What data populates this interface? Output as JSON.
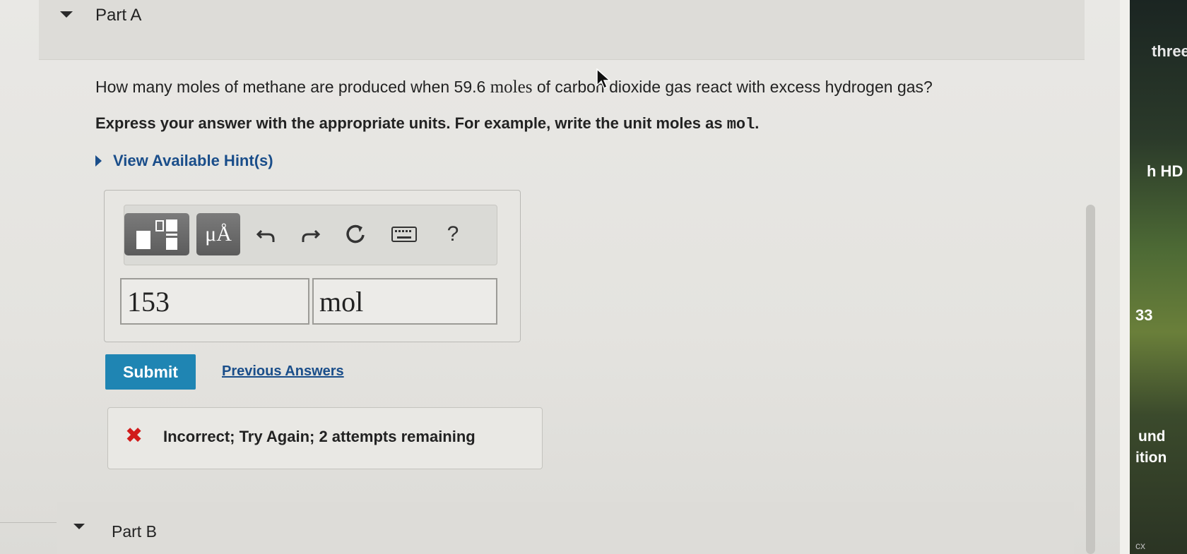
{
  "part_a": {
    "title": "Part A"
  },
  "question": {
    "prefix": "How many moles of methane are produced when 59.6",
    "unit_word": "moles",
    "suffix": "of carbon dioxide gas react with excess hydrogen gas?"
  },
  "instruction": {
    "text": "Express your answer with the appropriate units. For example, write the unit moles as",
    "code": "mol",
    "end": "."
  },
  "hints": {
    "label": "View Available Hint(s)"
  },
  "toolbar": {
    "units_label": "μÅ",
    "help_label": "?",
    "icons": [
      "template-icon",
      "units-icon",
      "undo-icon",
      "redo-icon",
      "reset-icon",
      "keyboard-icon",
      "help-icon"
    ]
  },
  "answer": {
    "value": "153",
    "unit": "mol"
  },
  "actions": {
    "submit_label": "Submit",
    "previous_answers_label": "Previous Answers"
  },
  "feedback": {
    "icon": "✖",
    "text": "Incorrect; Try Again; 2 attempts remaining"
  },
  "part_b": {
    "title": "Part B"
  },
  "side_panel": {
    "texts": [
      "three",
      "h HD",
      "33",
      "und",
      "ition",
      "cx"
    ]
  },
  "colors": {
    "accent": "#1f85b3",
    "link": "#1a4e8a",
    "error": "#d11a1a"
  }
}
